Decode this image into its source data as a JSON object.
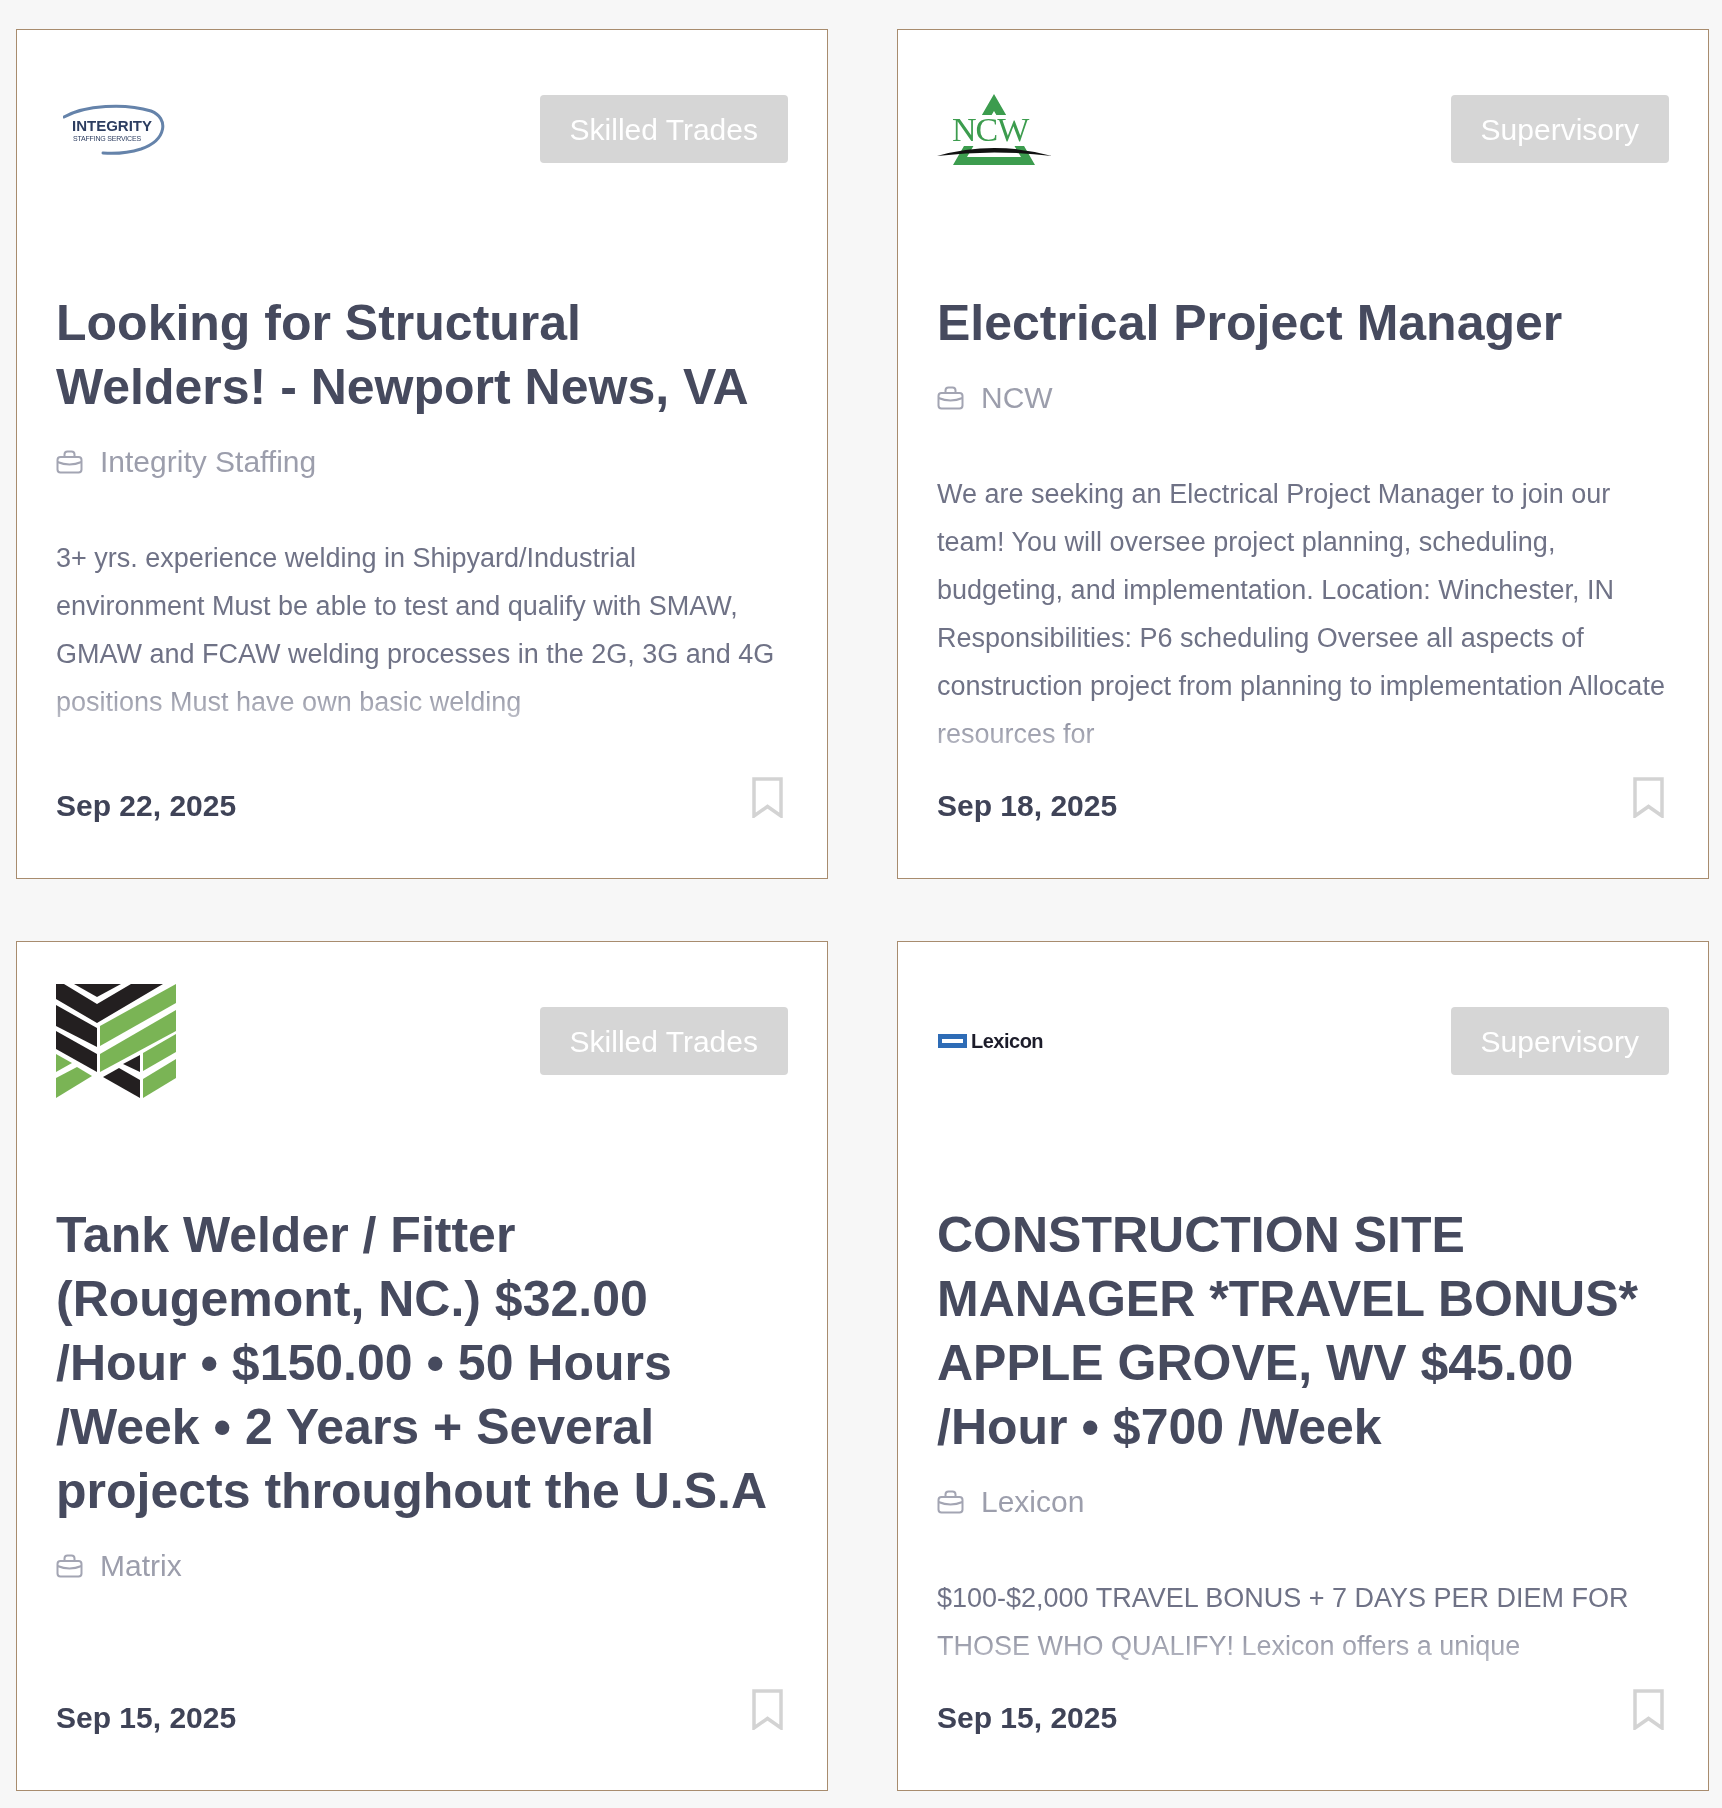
{
  "cards": [
    {
      "logo": {
        "kind": "swoosh",
        "text": "INTEGRITY",
        "subtext": "STAFFING SERVICES"
      },
      "category": "Skilled Trades",
      "title": "Looking for Structural Welders! - Newport News, VA",
      "company": "Integrity Staffing",
      "description": "3+ yrs. experience welding in Shipyard/Industrial environment Must be able to test and qualify with SMAW, GMAW and FCAW welding processes in the 2G, 3G and 4G positions Must have own basic welding",
      "date": "Sep 22, 2025"
    },
    {
      "logo": {
        "kind": "triangle",
        "text": "NCW"
      },
      "category": "Supervisory",
      "title": "Electrical Project Manager",
      "company": "NCW",
      "description": "We are seeking an Electrical Project Manager to join our team! You will oversee project planning, scheduling, budgeting, and implementation. Location: Winchester, IN Responsibilities: P6 scheduling Oversee all aspects of construction project from planning to implementation Allocate resources for",
      "date": "Sep 18, 2025"
    },
    {
      "logo": {
        "kind": "stripes"
      },
      "category": "Skilled Trades",
      "title": "Tank Welder / Fitter (Rougemont, NC.) $32.00 /Hour • $150.00 • 50 Hours /Week • 2 Years + Several projects throughout the U.S.A",
      "company": "Matrix",
      "date": "Sep 15, 2025"
    },
    {
      "logo": {
        "kind": "bars",
        "text": "Lexicon"
      },
      "category": "Supervisory",
      "title": "CONSTRUCTION SITE MANAGER *TRAVEL BONUS* APPLE GROVE, WV $45.00 /Hour • $700 /Week",
      "company": "Lexicon",
      "description": "$100-$2,000 TRAVEL BONUS + 7 DAYS PER DIEM FOR THOSE WHO QUALIFY! Lexicon offers a unique",
      "date": "Sep 15, 2025"
    }
  ]
}
